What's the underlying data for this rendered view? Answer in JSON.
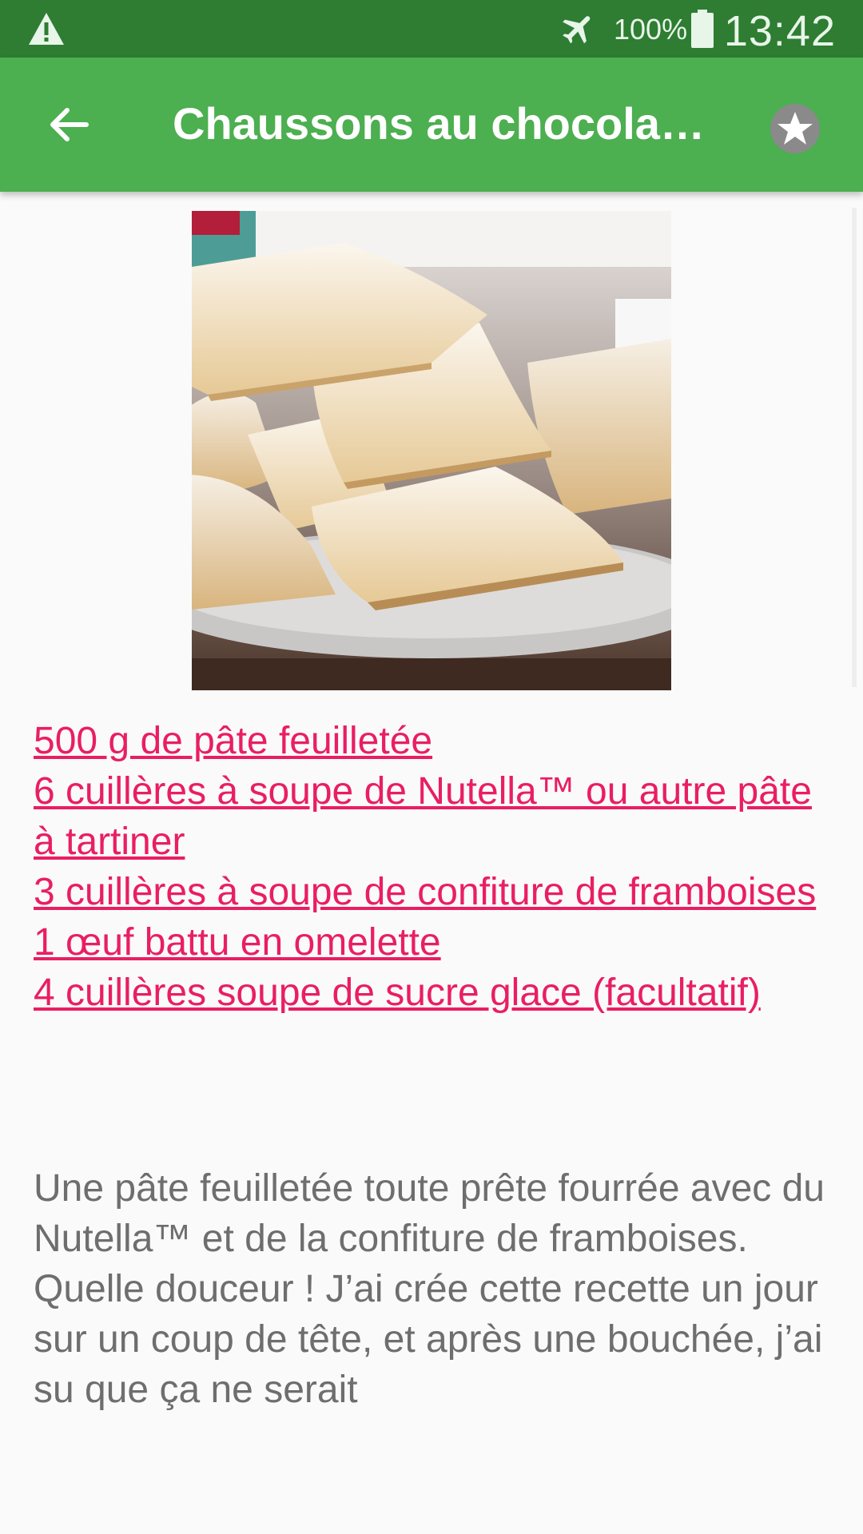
{
  "status_bar": {
    "battery_percent": "100%",
    "time": "13:42",
    "icons": [
      "warning-icon",
      "airplane-mode-icon",
      "battery-icon"
    ]
  },
  "app_bar": {
    "title": "Chaussons au chocolat…",
    "back_icon": "arrow-left-icon",
    "favorite_icon": "star-icon"
  },
  "colors": {
    "status_bar": "#2e7d32",
    "app_bar": "#4caf50",
    "ingredient_link": "#e91e63",
    "body_text": "#6e6e6e",
    "background": "#fafafa"
  },
  "ingredients": [
    "500 g de pâte feuilletée",
    "6 cuillères à soupe de Nutella™ ou autre pâte à tartiner",
    "3 cuillères à soupe de confiture de framboises",
    "1 œuf battu en omelette",
    "4 cuillères soupe de sucre glace (facultatif)"
  ],
  "description": "Une pâte feuilletée toute prête fourrée avec du Nutella™ et de la confiture de framboises. Quelle douceur ! J’ai crée cette recette un jour sur un coup de tête, et après une bouchée, j’ai su que ça ne serait"
}
